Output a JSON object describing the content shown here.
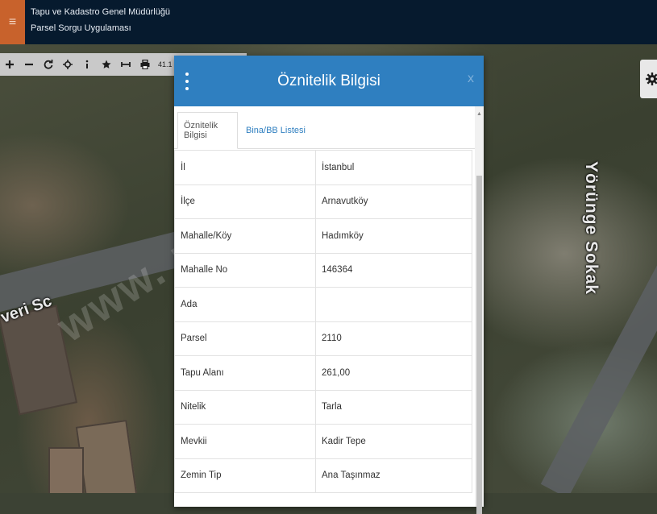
{
  "header": {
    "org_name": "Tapu ve Kadastro Genel Müdürlüğü",
    "app_name": "Parsel Sorgu Uygulaması",
    "menu_icon": "≡"
  },
  "toolbar": {
    "icons": [
      "zoom-in-icon",
      "zoom-out-icon",
      "refresh-icon",
      "locate-icon",
      "info-icon",
      "star-icon",
      "measure-icon",
      "print-icon"
    ],
    "coord_text": "41.1"
  },
  "map": {
    "street_right": "Yörünge Sokak",
    "street_left": "veri Sc",
    "watermark": "www.        net.tr"
  },
  "dialog": {
    "title": "Öznitelik Bilgisi",
    "close_label": "x",
    "tabs": [
      {
        "label": "Öznitelik Bilgisi",
        "active": true
      },
      {
        "label": "Bina/BB Listesi",
        "active": false
      }
    ],
    "rows": [
      {
        "key": "İl",
        "value": "İstanbul"
      },
      {
        "key": "İlçe",
        "value": "Arnavutköy"
      },
      {
        "key": "Mahalle/Köy",
        "value": "Hadımköy"
      },
      {
        "key": "Mahalle No",
        "value": "146364"
      },
      {
        "key": "Ada",
        "value": ""
      },
      {
        "key": "Parsel",
        "value": "2110"
      },
      {
        "key": "Tapu Alanı",
        "value": "261,00"
      },
      {
        "key": "Nitelik",
        "value": "Tarla"
      },
      {
        "key": "Mevkii",
        "value": "Kadir Tepe"
      },
      {
        "key": "Zemin Tip",
        "value": "Ana Taşınmaz"
      }
    ]
  },
  "colors": {
    "header_bg": "#061a2e",
    "menu_accent": "#c8622c",
    "dialog_header": "#2f7fc0",
    "tab_link": "#2f7fc0"
  }
}
